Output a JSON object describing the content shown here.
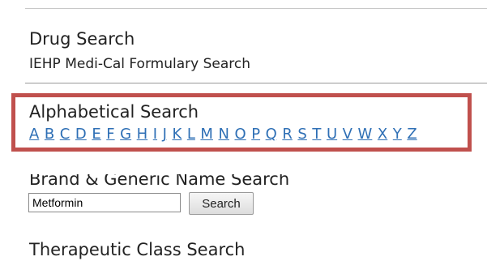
{
  "drug_search": {
    "title": "Drug Search",
    "subtitle": "IEHP Medi-Cal Formulary Search"
  },
  "alphabetical": {
    "title": "Alphabetical Search",
    "letters": [
      "A",
      "B",
      "C",
      "D",
      "E",
      "F",
      "G",
      "H",
      "I",
      "J",
      "K",
      "L",
      "M",
      "N",
      "O",
      "P",
      "Q",
      "R",
      "S",
      "T",
      "U",
      "V",
      "W",
      "X",
      "Y",
      "Z"
    ],
    "highlight_color": "#c0504d",
    "link_color": "#2e6fb5"
  },
  "brand_generic": {
    "title": "Brand & Generic Name Search",
    "input_value": "Metformin",
    "button_label": "Search"
  },
  "therapeutic": {
    "title": "Therapeutic Class Search"
  }
}
